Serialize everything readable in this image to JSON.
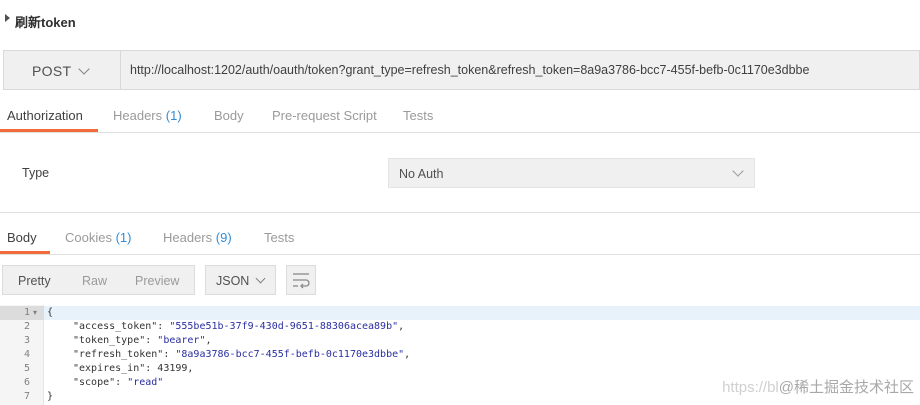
{
  "request": {
    "name": "刷新token",
    "method": "POST",
    "url": "http://localhost:1202/auth/oauth/token?grant_type=refresh_token&refresh_token=8a9a3786-bcc7-455f-befb-0c1170e3dbbe"
  },
  "request_tabs": [
    {
      "label": "Authorization",
      "count": ""
    },
    {
      "label": "Headers",
      "count": "(1)"
    },
    {
      "label": "Body",
      "count": ""
    },
    {
      "label": "Pre-request Script",
      "count": ""
    },
    {
      "label": "Tests",
      "count": ""
    }
  ],
  "auth": {
    "type_label": "Type",
    "type_value": "No Auth"
  },
  "response_tabs": [
    {
      "label": "Body",
      "count": ""
    },
    {
      "label": "Cookies",
      "count": "(1)"
    },
    {
      "label": "Headers",
      "count": "(9)"
    },
    {
      "label": "Tests",
      "count": ""
    }
  ],
  "body_view": {
    "formats": [
      "Pretty",
      "Raw",
      "Preview"
    ],
    "active_format": "Pretty",
    "language": "JSON"
  },
  "response_body": {
    "line_numbers": [
      "1",
      "2",
      "3",
      "4",
      "5",
      "6",
      "7"
    ],
    "lines": [
      {
        "text": "{"
      },
      {
        "key": "\"access_token\"",
        "value": "\"555be51b-37f9-430d-9651-88306acea89b\"",
        "tail": ","
      },
      {
        "key": "\"token_type\"",
        "value": "\"bearer\"",
        "tail": ","
      },
      {
        "key": "\"refresh_token\"",
        "value": "\"8a9a3786-bcc7-455f-befb-0c1170e3dbbe\"",
        "tail": ","
      },
      {
        "key": "\"expires_in\"",
        "value": "43199",
        "tail": ","
      },
      {
        "key": "\"scope\"",
        "value": "\"read\"",
        "tail": ""
      },
      {
        "text": "}"
      }
    ]
  },
  "watermark": {
    "url_part": "https://bl",
    "text": "@稀土掘金技术社区"
  },
  "colors": {
    "accent_underline": "#f26b3a",
    "count_blue": "#2f8dd8",
    "string_value": "#2a2ea0"
  }
}
